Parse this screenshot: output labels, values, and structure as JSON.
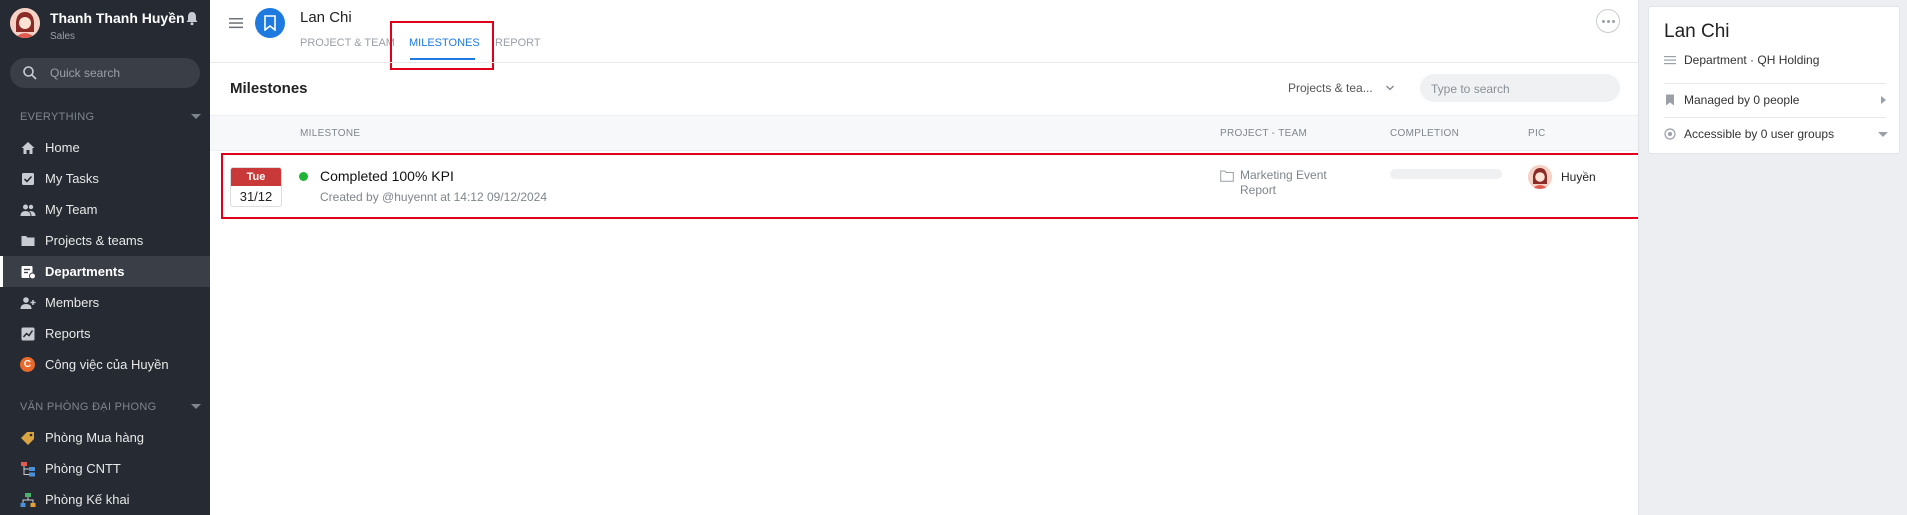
{
  "user": {
    "name": "Thanh Thanh Huyền",
    "role": "Sales"
  },
  "sidebar": {
    "search_placeholder": "Quick search",
    "section_everything": "EVERYTHING",
    "items": [
      {
        "label": "Home",
        "icon": "home-icon"
      },
      {
        "label": "My Tasks",
        "icon": "checkbox-icon"
      },
      {
        "label": "My Team",
        "icon": "team-icon"
      },
      {
        "label": "Projects & teams",
        "icon": "folder-icon"
      },
      {
        "label": "Departments",
        "icon": "department-icon",
        "active": true
      },
      {
        "label": "Members",
        "icon": "member-add-icon"
      },
      {
        "label": "Reports",
        "icon": "chart-icon"
      },
      {
        "label": "Công việc của Huyền",
        "icon": "c-badge-icon",
        "badge": "C"
      }
    ],
    "section_office": "VĂN PHÒNG ĐẠI PHONG",
    "office_items": [
      {
        "label": "Phòng Mua hàng",
        "icon": "tag-icon"
      },
      {
        "label": "Phòng CNTT",
        "icon": "org-chart-icon"
      },
      {
        "label": "Phòng Kế khai",
        "icon": "network-icon"
      }
    ]
  },
  "header": {
    "title": "Lan Chi",
    "tabs": [
      {
        "label": "PROJECT & TEAM"
      },
      {
        "label": "MILESTONES",
        "active": true
      },
      {
        "label": "REPORT"
      }
    ]
  },
  "milestones": {
    "title": "Milestones",
    "filter_label": "Projects & tea...",
    "search_placeholder": "Type to search",
    "columns": {
      "milestone": "MILESTONE",
      "project_team": "PROJECT - TEAM",
      "completion": "COMPLETION",
      "pic": "PIC"
    },
    "rows": [
      {
        "day": "Tue",
        "date": "31/12",
        "name": "Completed 100% KPI",
        "meta": "Created by @huyennt at 14:12 09/12/2024",
        "project": "Marketing Event Report",
        "completion": 0,
        "pic": "Huyền",
        "status_color": "#20b534"
      }
    ]
  },
  "panel": {
    "title": "Lan Chi",
    "department": "Department · QH Holding",
    "managed": "Managed by 0 people",
    "accessible": "Accessible by 0 user groups"
  },
  "colors": {
    "accent": "#1f7ae0",
    "sidebar_bg": "#262b33",
    "date_header": "#c9393a",
    "highlight_box": "#e0001b"
  }
}
